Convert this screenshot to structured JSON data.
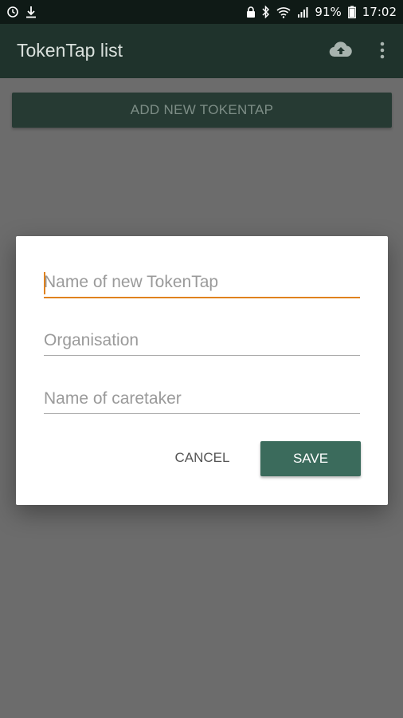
{
  "status_bar": {
    "battery_percent": "91%",
    "time": "17:02",
    "icons": [
      "alarm-icon",
      "download-icon",
      "lock-icon",
      "bluetooth-icon",
      "wifi-icon",
      "signal-icon",
      "battery-icon"
    ]
  },
  "app_bar": {
    "title": "TokenTap list",
    "actions": [
      "cloud-upload-icon",
      "overflow-menu-icon"
    ]
  },
  "main": {
    "add_button_label": "ADD NEW TOKENTAP"
  },
  "dialog": {
    "fields": [
      {
        "placeholder": "Name of new TokenTap",
        "value": ""
      },
      {
        "placeholder": "Organisation",
        "value": ""
      },
      {
        "placeholder": "Name of caretaker",
        "value": ""
      }
    ],
    "cancel_label": "CANCEL",
    "save_label": "SAVE"
  },
  "colors": {
    "status_bar": "#0f1a16",
    "app_bar": "#1f332c",
    "scrim": "#6c6c6c",
    "accent": "#e0821e",
    "primary_button": "#3b6b5c"
  }
}
